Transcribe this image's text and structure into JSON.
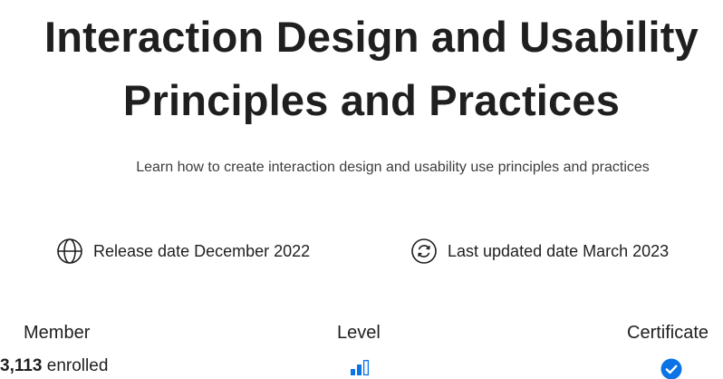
{
  "course": {
    "title_line1": "Interaction Design and Usability",
    "title_line2": "Principles and Practices",
    "subtitle": "Learn how to create interaction design and usability use principles and practices"
  },
  "meta": {
    "release": {
      "label": "Release date December 2022",
      "icon": "globe-icon"
    },
    "updated": {
      "label": "Last updated date March 2023",
      "icon": "refresh-icon"
    }
  },
  "stats": {
    "member": {
      "label": "Member",
      "count": "3,113",
      "suffix": "enrolled"
    },
    "level": {
      "label": "Level",
      "icon": "level-bars-icon",
      "filled_bars": 2,
      "total_bars": 3
    },
    "certificate": {
      "label": "Certificate",
      "icon": "check-circle-icon"
    }
  },
  "colors": {
    "text": "#1f1f1f",
    "accent": "#0a74e6"
  }
}
